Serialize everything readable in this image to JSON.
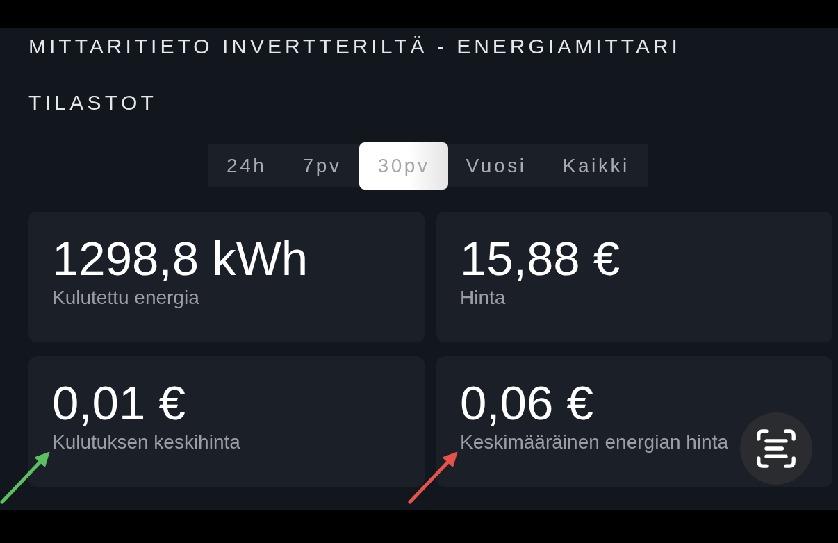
{
  "header": {
    "title": "MITTARITIETO INVERTTERILTÄ - ENERGIAMITTARI",
    "section": "TILASTOT"
  },
  "period_tabs": [
    {
      "label": "24h",
      "selected": false
    },
    {
      "label": "7pv",
      "selected": false
    },
    {
      "label": "30pv",
      "selected": true
    },
    {
      "label": "Vuosi",
      "selected": false
    },
    {
      "label": "Kaikki",
      "selected": false
    }
  ],
  "stats": [
    {
      "value": "1298,8 kWh",
      "label": "Kulutettu energia"
    },
    {
      "value": "15,88 €",
      "label": "Hinta"
    },
    {
      "value": "0,01 €",
      "label": "Kulutuksen keskihinta",
      "annotation_arrow": {
        "color": "#5cbf60"
      }
    },
    {
      "value": "0,06 €",
      "label": "Keskimääräinen energian hinta",
      "annotation_arrow": {
        "color": "#e5534b"
      }
    }
  ]
}
